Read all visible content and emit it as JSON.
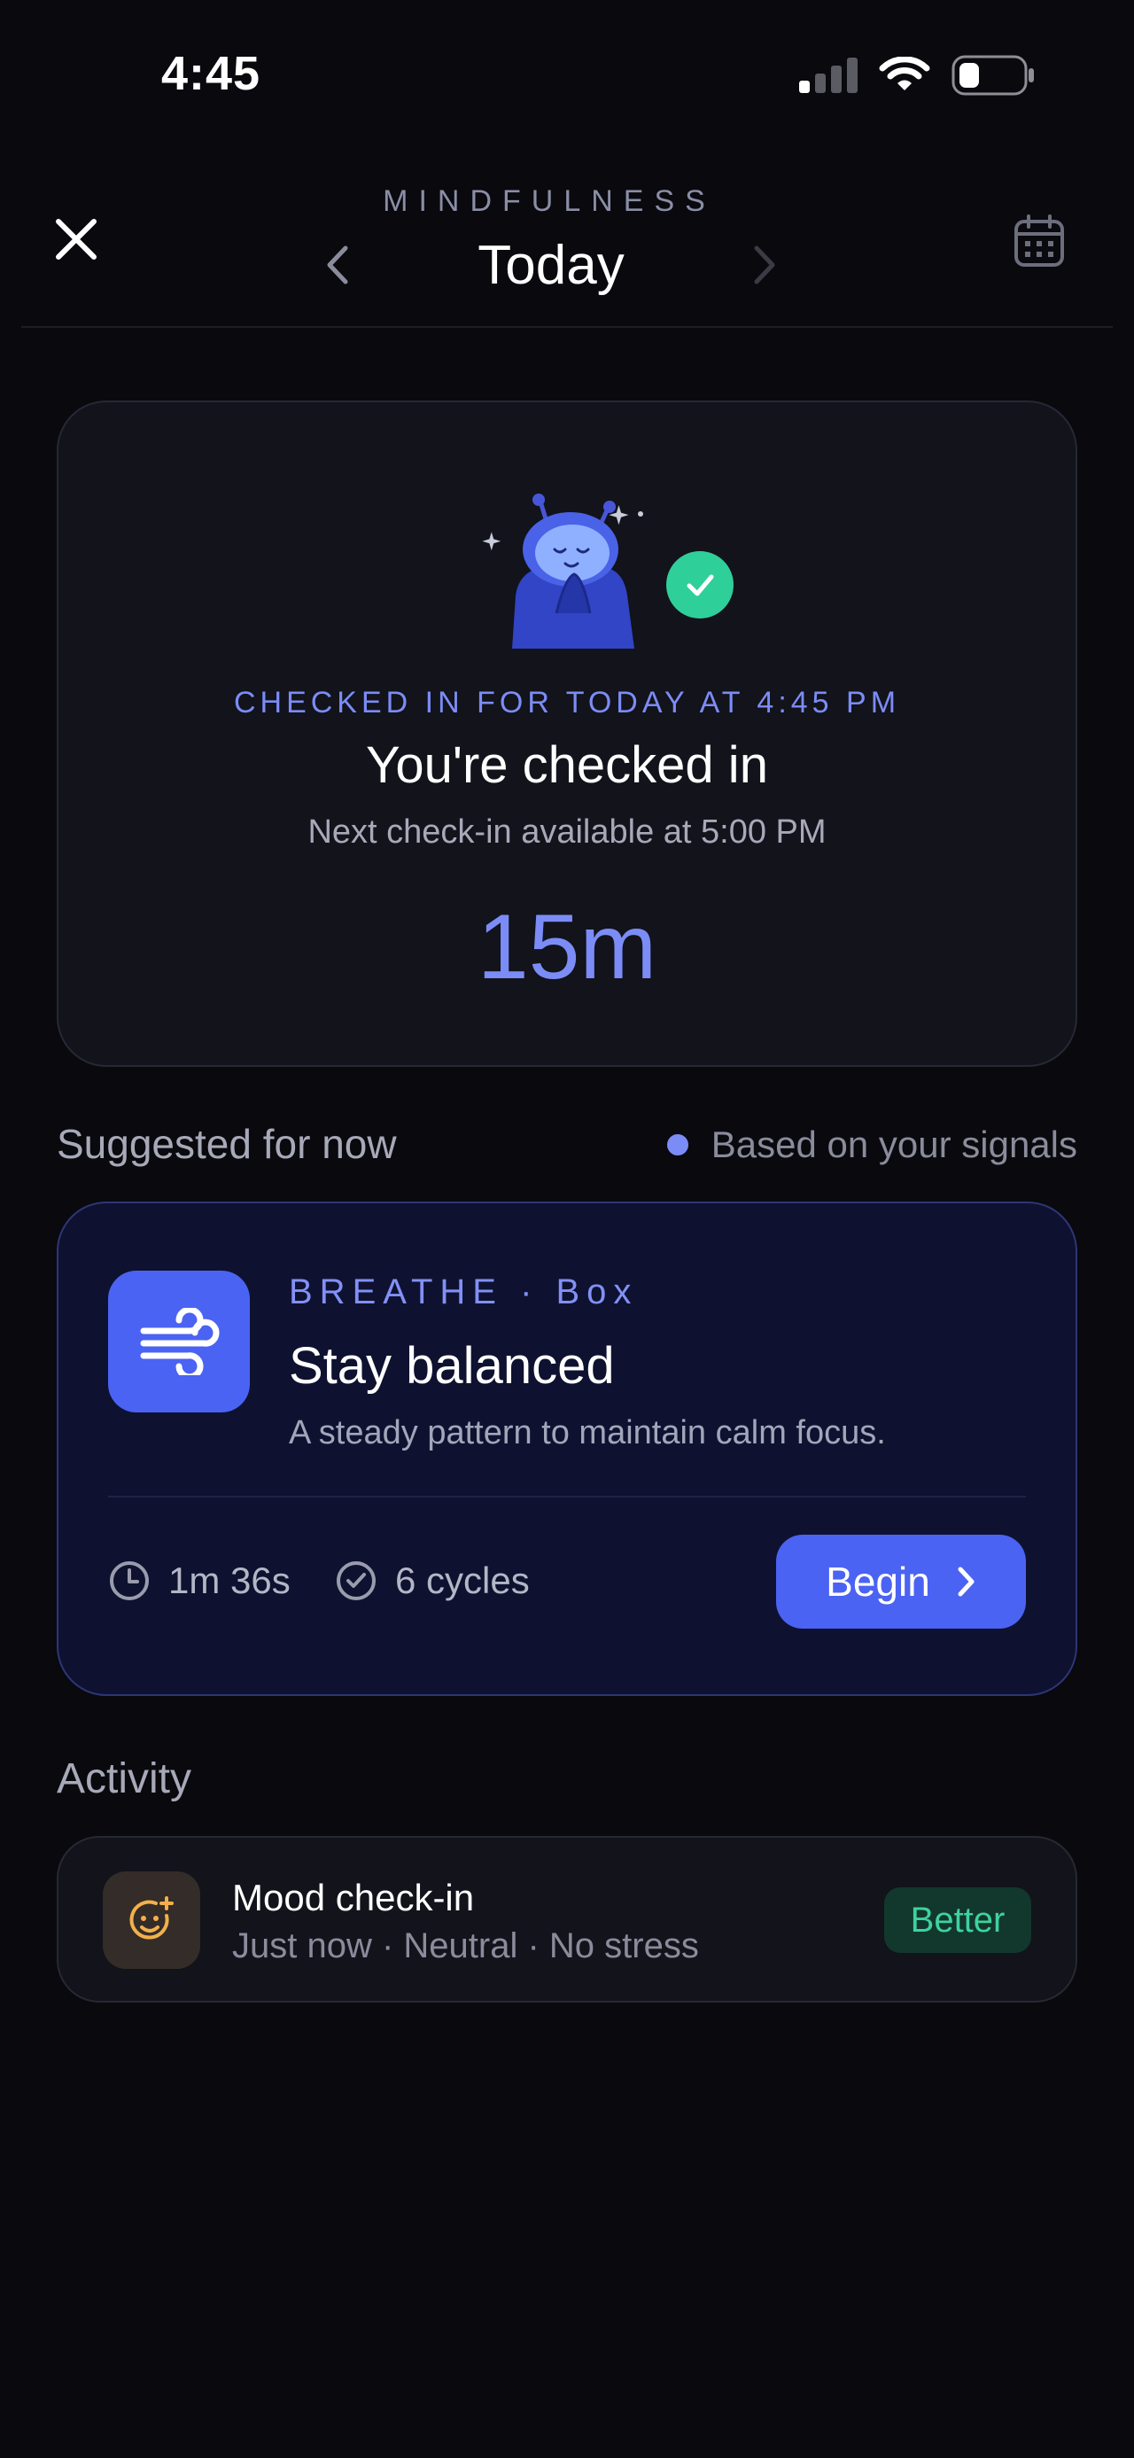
{
  "status_bar": {
    "time": "4:45",
    "icons": [
      "cellular-signal-icon",
      "wifi-icon",
      "battery-icon"
    ]
  },
  "header": {
    "eyebrow": "MINDFULNESS",
    "title": "Today",
    "icons": [
      "close-icon",
      "chevron-left-icon",
      "chevron-right-icon",
      "calendar-icon"
    ]
  },
  "checkin": {
    "eyebrow": "CHECKED IN FOR TODAY AT 4:45 PM",
    "title": "You're checked in",
    "subtitle": "Next check-in available at 5:00 PM",
    "countdown": "15m"
  },
  "suggested": {
    "title": "Suggested for now",
    "signals_label": "Based on your signals",
    "card": {
      "eyebrow": "BREATHE · Box",
      "title": "Stay balanced",
      "description": "A steady pattern to maintain calm focus.",
      "duration": "1m 36s",
      "cycles": "6 cycles",
      "begin_label": "Begin"
    }
  },
  "activity": {
    "title": "Activity",
    "items": [
      {
        "name": "Mood check-in",
        "detail": "Just now · Neutral · No stress",
        "badge": "Better"
      }
    ]
  },
  "colors": {
    "background": "#09090e",
    "accent": "#4b63f2",
    "accent_text": "#7c8cf6",
    "success": "#2fcf9a"
  }
}
